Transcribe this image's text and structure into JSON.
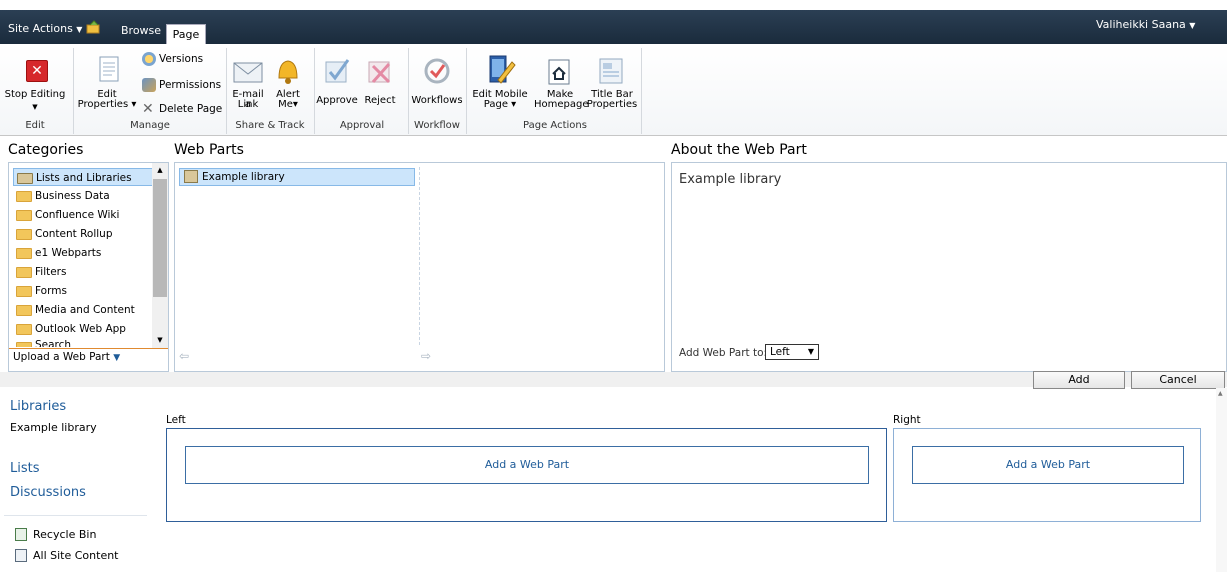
{
  "topbar": {
    "site_actions": "Site Actions",
    "browse_tab": "Browse",
    "page_tab": "Page",
    "user_name": "Valiheikki Saana"
  },
  "ribbon": {
    "edit": {
      "stop_editing": "Stop Editing",
      "group": "Edit"
    },
    "manage": {
      "edit_properties_1": "Edit",
      "edit_properties_2": "Properties",
      "versions": "Versions",
      "permissions": "Permissions",
      "delete_page": "Delete Page",
      "group": "Manage"
    },
    "share": {
      "email_1": "E-mail a",
      "email_2": "Link",
      "alert_1": "Alert",
      "alert_2": "Me",
      "group": "Share & Track"
    },
    "approval": {
      "approve": "Approve",
      "reject": "Reject",
      "group": "Approval"
    },
    "workflow": {
      "workflows": "Workflows",
      "group": "Workflow"
    },
    "page_actions": {
      "edit_mobile_1": "Edit Mobile",
      "edit_mobile_2": "Page",
      "make_home_1": "Make",
      "make_home_2": "Homepage",
      "title_bar_1": "Title Bar",
      "title_bar_2": "Properties",
      "group": "Page Actions"
    }
  },
  "gallery": {
    "categories_title": "Categories",
    "webparts_title": "Web Parts",
    "about_title": "About the Web Part",
    "categories": [
      "Lists and Libraries",
      "Business Data",
      "Confluence Wiki",
      "Content Rollup",
      "e1 Webparts",
      "Filters",
      "Forms",
      "Media and Content",
      "Outlook Web App",
      "Search"
    ],
    "upload": "Upload a Web Part",
    "webparts": [
      "Example library"
    ],
    "about_name": "Example library",
    "add_to_label": "Add Web Part to:",
    "add_to_value": "Left",
    "add_button": "Add",
    "cancel_button": "Cancel"
  },
  "quicklaunch": {
    "libraries": "Libraries",
    "example_library": "Example library",
    "lists": "Lists",
    "discussions": "Discussions",
    "recycle_bin": "Recycle Bin",
    "all_site_content": "All Site Content"
  },
  "zones": {
    "left_label": "Left",
    "right_label": "Right",
    "add_web_part": "Add a Web Part"
  }
}
